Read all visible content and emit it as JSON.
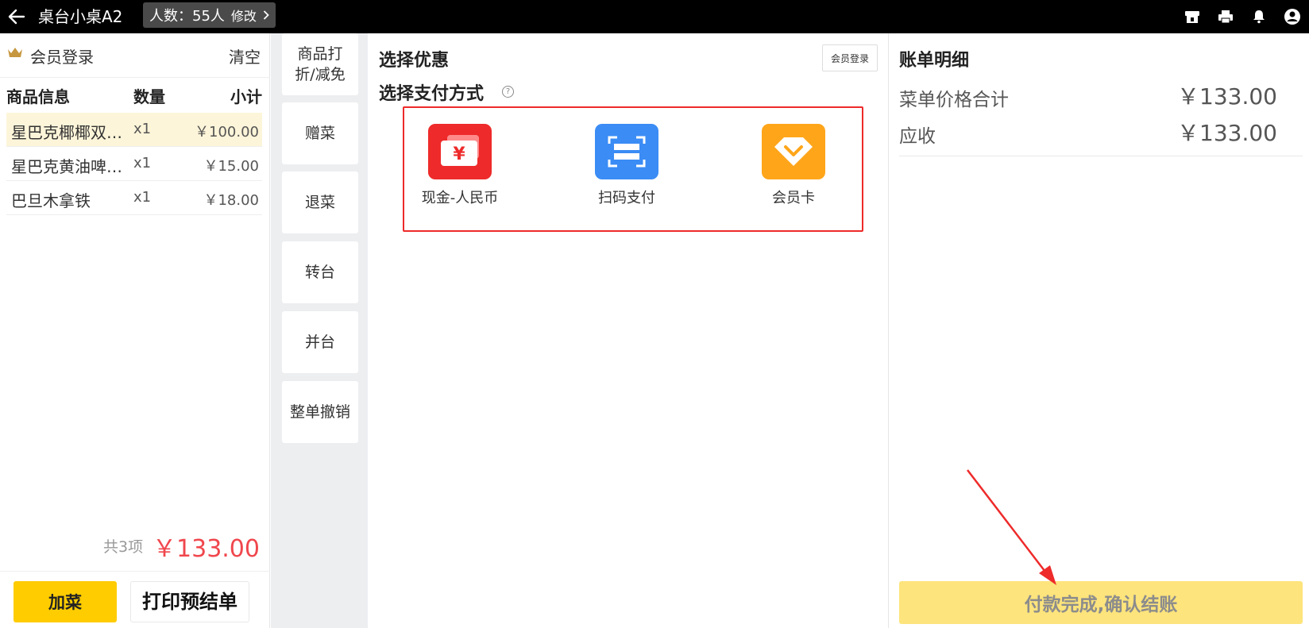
{
  "topbar": {
    "title": "桌台小桌A2",
    "people": "人数：55人",
    "edit": "修改"
  },
  "left": {
    "member_login": "会员登录",
    "clear": "清空",
    "headers": {
      "info": "商品信息",
      "qty": "数量",
      "subtotal": "小计"
    },
    "items": [
      {
        "name": "星巴克椰椰双…",
        "qty": "x1",
        "price": "￥100.00"
      },
      {
        "name": "星巴克黄油啤…",
        "qty": "x1",
        "price": "￥15.00"
      },
      {
        "name": "巴旦木拿铁",
        "qty": "x1",
        "price": "￥18.00"
      }
    ],
    "total_count": "共3项",
    "total_amount": "￥133.00",
    "add_dish": "加菜",
    "print_prebill": "打印预结单"
  },
  "actions": {
    "discount": "商品打折/减免",
    "gift": "赠菜",
    "return": "退菜",
    "transfer": "转台",
    "merge": "并台",
    "cancel_all": "整单撤销"
  },
  "main": {
    "select_discount": "选择优惠",
    "member_login": "会员登录",
    "select_payment": "选择支付方式",
    "help_glyph": "?",
    "payments": [
      {
        "label": "现金-人民币",
        "icon": "cash-icon",
        "color": "#ee2a2a"
      },
      {
        "label": "扫码支付",
        "icon": "scan-icon",
        "color": "#3b8cf5"
      },
      {
        "label": "会员卡",
        "icon": "member-card-icon",
        "color": "#ffa51a"
      }
    ],
    "highlight_color": "#ee2a2a"
  },
  "right": {
    "title": "账单明细",
    "rows": [
      {
        "label": "菜单价格合计",
        "value": "￥133.00"
      },
      {
        "label": "应收",
        "value": "￥133.00"
      }
    ],
    "confirm": "付款完成,确认结账"
  },
  "colors": {
    "accent_yellow": "#ffcc00",
    "confirm_disabled": "#fde47c",
    "price_red": "#f0474d",
    "annotation_red": "#ee2a2a"
  }
}
